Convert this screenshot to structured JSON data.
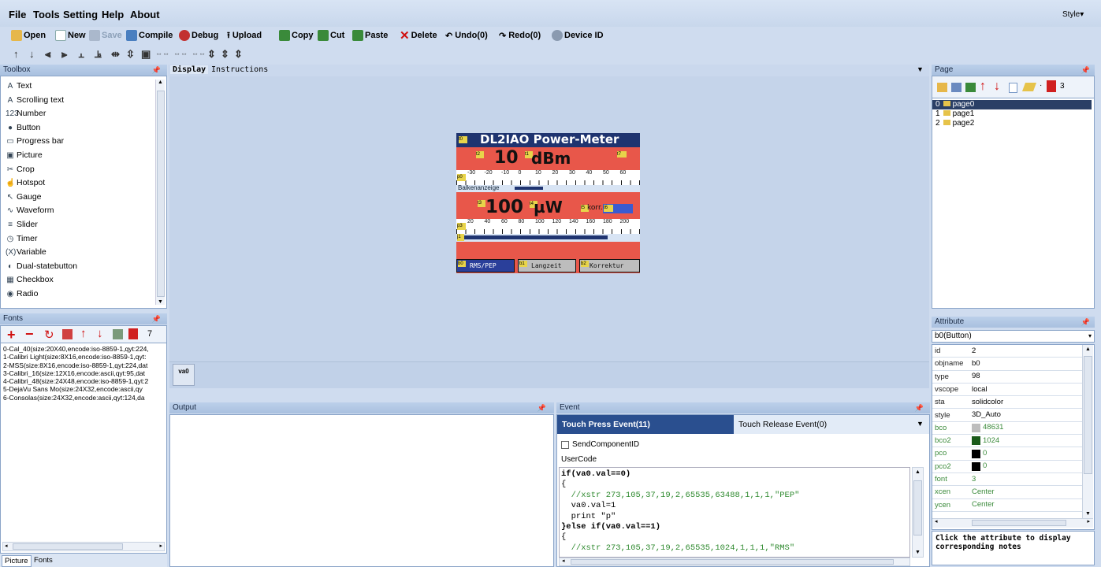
{
  "menu": [
    "File",
    "Tools",
    "Setting",
    "Help",
    "About"
  ],
  "style_label": "Style",
  "toolbar": {
    "open": "Open",
    "new": "New",
    "save": "Save",
    "compile": "Compile",
    "debug": "Debug",
    "upload": "Upload",
    "copy": "Copy",
    "cut": "Cut",
    "paste": "Paste",
    "delete": "Delete",
    "undo": "Undo(0)",
    "redo": "Redo(0)",
    "device_id": "Device ID"
  },
  "toolbox": {
    "title": "Toolbox",
    "items": [
      {
        "label": "Text",
        "icon": "A"
      },
      {
        "label": "Scrolling text",
        "icon": "A"
      },
      {
        "label": "Number",
        "icon": "123"
      },
      {
        "label": "Button",
        "icon": "●"
      },
      {
        "label": "Progress bar",
        "icon": "▭"
      },
      {
        "label": "Picture",
        "icon": "▣"
      },
      {
        "label": "Crop",
        "icon": "✂"
      },
      {
        "label": "Hotspot",
        "icon": "☝"
      },
      {
        "label": "Gauge",
        "icon": "↖"
      },
      {
        "label": "Waveform",
        "icon": "∿"
      },
      {
        "label": "Slider",
        "icon": "≡"
      },
      {
        "label": "Timer",
        "icon": "◷"
      },
      {
        "label": "Variable",
        "icon": "(X)"
      },
      {
        "label": "Dual-statebutton",
        "icon": "◐"
      },
      {
        "label": "Checkbox",
        "icon": "▦"
      },
      {
        "label": "Radio",
        "icon": "◉"
      }
    ]
  },
  "fonts": {
    "title": "Fonts",
    "count": "7",
    "items": [
      "0-Cal_40(size:20X40,encode:iso-8859-1,qyt:224,",
      "1-Calibri Light(size:8X16,encode:iso-8859-1,qyt:",
      "2-MSS(size:8X16,encode:iso-8859-1,qyt:224,dat",
      "3-Calibri_16(size:12X16,encode:ascii,qyt:95,dat",
      "4-Calibri_48(size:24X48,encode:iso-8859-1,qyt:2",
      "5-DejaVu Sans Mo(size:24X32,encode:ascii,qy",
      "6-Consolas(size:24X32,encode:ascii,qyt:124,da"
    ],
    "bottom_tabs": [
      "Picture",
      "Fonts"
    ]
  },
  "editor": {
    "tabs": [
      "Display",
      "Instructions"
    ],
    "hidden_component": "va0"
  },
  "device": {
    "title": "DL2IAO Power-Meter",
    "dbm_value": "10",
    "dbm_unit": "dBm",
    "scale1": [
      "-30",
      "-20",
      "-10",
      "0",
      "10",
      "20",
      "30",
      "40",
      "50",
      "60"
    ],
    "bar_label": "Balkenanzeige",
    "mw_value": "100",
    "mw_unit": "µW",
    "korr_label": "korr.",
    "scale2": [
      "20",
      "40",
      "60",
      "80",
      "100",
      "120",
      "140",
      "160",
      "180",
      "200"
    ],
    "buttons": [
      "RMS/PEP",
      "Langzeit",
      "Korrektur"
    ],
    "tags": [
      "t0",
      "t2",
      "t1",
      "t7",
      "p0",
      "p2",
      "t3",
      "t4",
      "t5",
      "t6",
      "p3",
      "j1",
      "b0",
      "b1",
      "b2"
    ]
  },
  "output": {
    "title": "Output"
  },
  "event": {
    "title": "Event",
    "tabs": [
      "Touch Press Event(11)",
      "Touch Release Event(0)"
    ],
    "send_component_id": "SendComponentID",
    "usercode_label": "UserCode",
    "code": [
      "if(va0.val==0)",
      "{",
      "  //xstr 273,105,37,19,2,65535,63488,1,1,1,\"PEP\"",
      "  va0.val=1",
      "  print \"p\"",
      "}else if(va0.val==1)",
      "{",
      "  //xstr 273,105,37,19,2,65535,1024,1,1,1,\"RMS\""
    ]
  },
  "page": {
    "title": "Page",
    "count": "3",
    "items": [
      {
        "index": "0",
        "name": "page0"
      },
      {
        "index": "1",
        "name": "page1"
      },
      {
        "index": "2",
        "name": "page2"
      }
    ]
  },
  "attribute": {
    "title": "Attribute",
    "selected": "b0(Button)",
    "rows": [
      {
        "k": "id",
        "v": "2"
      },
      {
        "k": "objname",
        "v": "b0"
      },
      {
        "k": "type",
        "v": "98"
      },
      {
        "k": "vscope",
        "v": "local"
      },
      {
        "k": "sta",
        "v": "solidcolor"
      },
      {
        "k": "style",
        "v": "3D_Auto"
      },
      {
        "k": "bco",
        "v": "48631",
        "swatch": "#bdbdbd"
      },
      {
        "k": "bco2",
        "v": "1024",
        "swatch": "#1a5a1a"
      },
      {
        "k": "pco",
        "v": "0",
        "swatch": "#000000"
      },
      {
        "k": "pco2",
        "v": "0",
        "swatch": "#000000"
      },
      {
        "k": "font",
        "v": "3"
      },
      {
        "k": "xcen",
        "v": "Center"
      },
      {
        "k": "ycen",
        "v": "Center"
      }
    ],
    "note": "Click the attribute to display corresponding notes"
  },
  "colors": {
    "canvas": "#c5d4ea",
    "device_bg": "#e8574a",
    "device_title": "#1f3470",
    "selection": "#2a3f66"
  }
}
